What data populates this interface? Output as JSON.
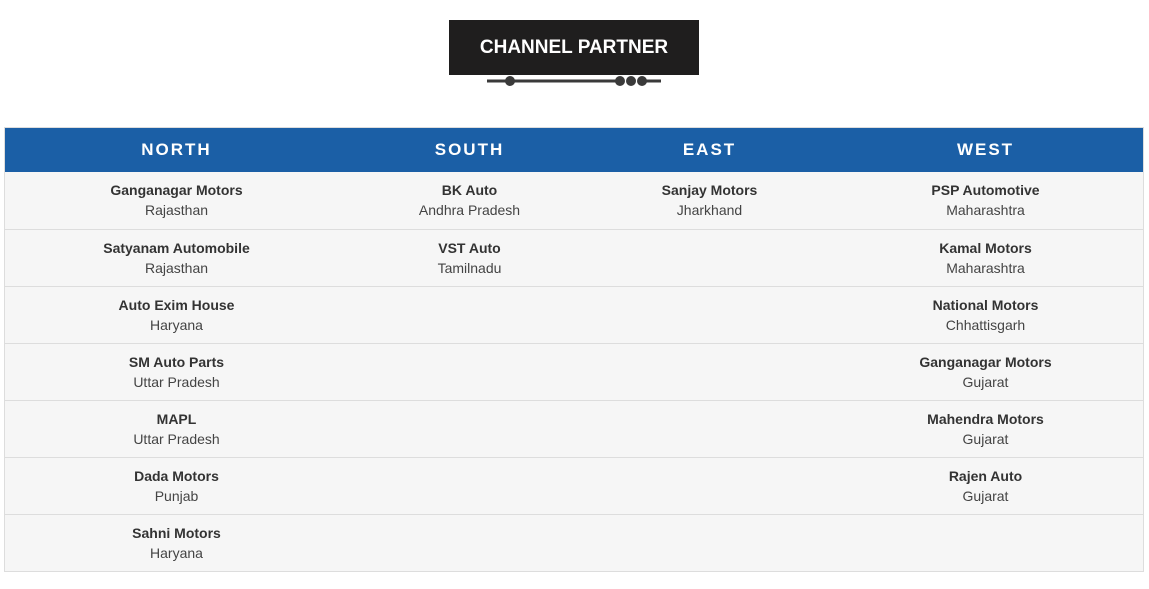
{
  "section_title": "CHANNEL PARTNER",
  "columns": {
    "north": "NORTH",
    "south": "SOUTH",
    "east": "EAST",
    "west": "WEST"
  },
  "rows": [
    {
      "north": {
        "name": "Ganganagar Motors",
        "state": "Rajasthan"
      },
      "south": {
        "name": "BK Auto",
        "state": "Andhra Pradesh"
      },
      "east": {
        "name": "Sanjay Motors",
        "state": "Jharkhand"
      },
      "west": {
        "name": "PSP Automotive",
        "state": "Maharashtra"
      }
    },
    {
      "north": {
        "name": "Satyanam Automobile",
        "state": "Rajasthan"
      },
      "south": {
        "name": "VST Auto",
        "state": "Tamilnadu"
      },
      "west": {
        "name": "Kamal Motors",
        "state": "Maharashtra"
      }
    },
    {
      "north": {
        "name": "Auto Exim House",
        "state": "Haryana"
      },
      "west": {
        "name": "National Motors",
        "state": "Chhattisgarh"
      }
    },
    {
      "north": {
        "name": "SM Auto Parts",
        "state": "Uttar Pradesh"
      },
      "west": {
        "name": "Ganganagar Motors",
        "state": "Gujarat"
      }
    },
    {
      "north": {
        "name": "MAPL",
        "state": "Uttar Pradesh"
      },
      "west": {
        "name": "Mahendra Motors",
        "state": "Gujarat"
      }
    },
    {
      "north": {
        "name": "Dada Motors",
        "state": "Punjab"
      },
      "west": {
        "name": "Rajen Auto",
        "state": "Gujarat"
      }
    },
    {
      "north": {
        "name": "Sahni Motors",
        "state": "Haryana"
      }
    }
  ],
  "colors": {
    "header_bg": "#1b5fa6",
    "title_bg": "#1f1e1e",
    "row_bg": "#f6f6f6"
  },
  "icons": {
    "title_decoration": "dot-line-divider-icon"
  }
}
